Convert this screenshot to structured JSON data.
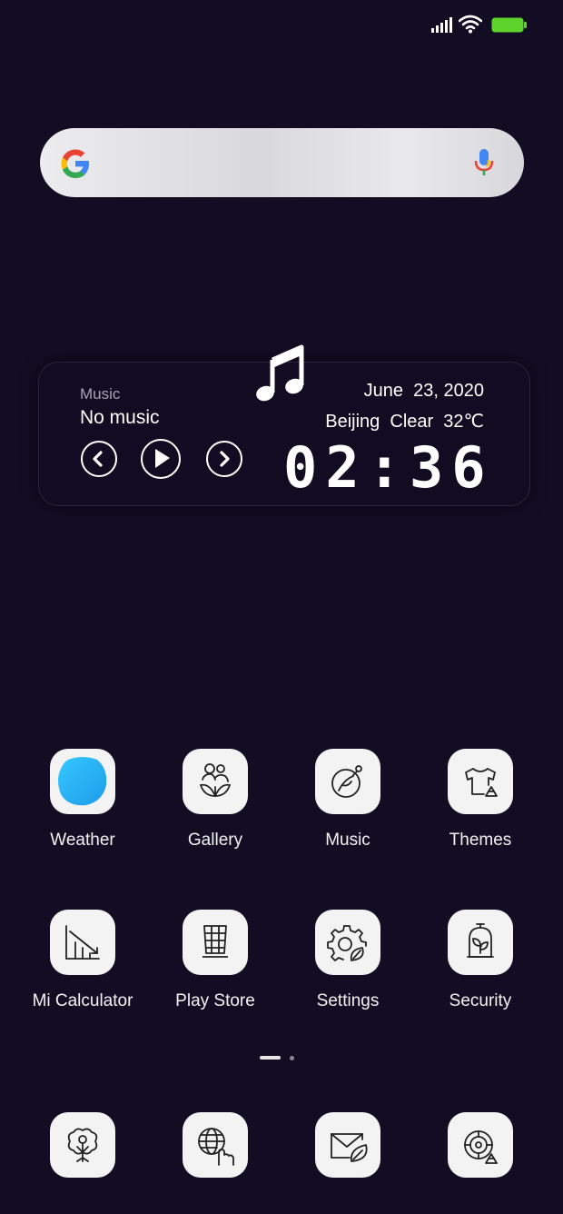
{
  "status_bar": {
    "icons": [
      "cellular-signal-icon",
      "wifi-icon",
      "battery-icon"
    ],
    "battery_color": "#5ed32c"
  },
  "search": {
    "icons": [
      "google-logo-icon",
      "microphone-icon"
    ]
  },
  "music_widget": {
    "label": "Music",
    "track": "No music",
    "controls": [
      "previous-icon",
      "play-icon",
      "next-icon"
    ],
    "date": "June  23, 2020",
    "weather": "Beijing  Clear  32℃",
    "time": "02:36"
  },
  "apps": [
    {
      "label": "Weather",
      "icon": "weather-icon"
    },
    {
      "label": "Gallery",
      "icon": "gallery-icon"
    },
    {
      "label": "Music",
      "icon": "music-icon"
    },
    {
      "label": "Themes",
      "icon": "themes-icon"
    },
    {
      "label": "Mi Calculator",
      "icon": "calculator-icon"
    },
    {
      "label": "Play Store",
      "icon": "play-store-icon"
    },
    {
      "label": "Settings",
      "icon": "settings-icon"
    },
    {
      "label": "Security",
      "icon": "security-icon"
    }
  ],
  "dock": [
    {
      "icon": "phone-tree-icon"
    },
    {
      "icon": "browser-icon"
    },
    {
      "icon": "messages-icon"
    },
    {
      "icon": "camera-icon"
    }
  ],
  "page_indicator": {
    "current": 1,
    "total": 2
  }
}
